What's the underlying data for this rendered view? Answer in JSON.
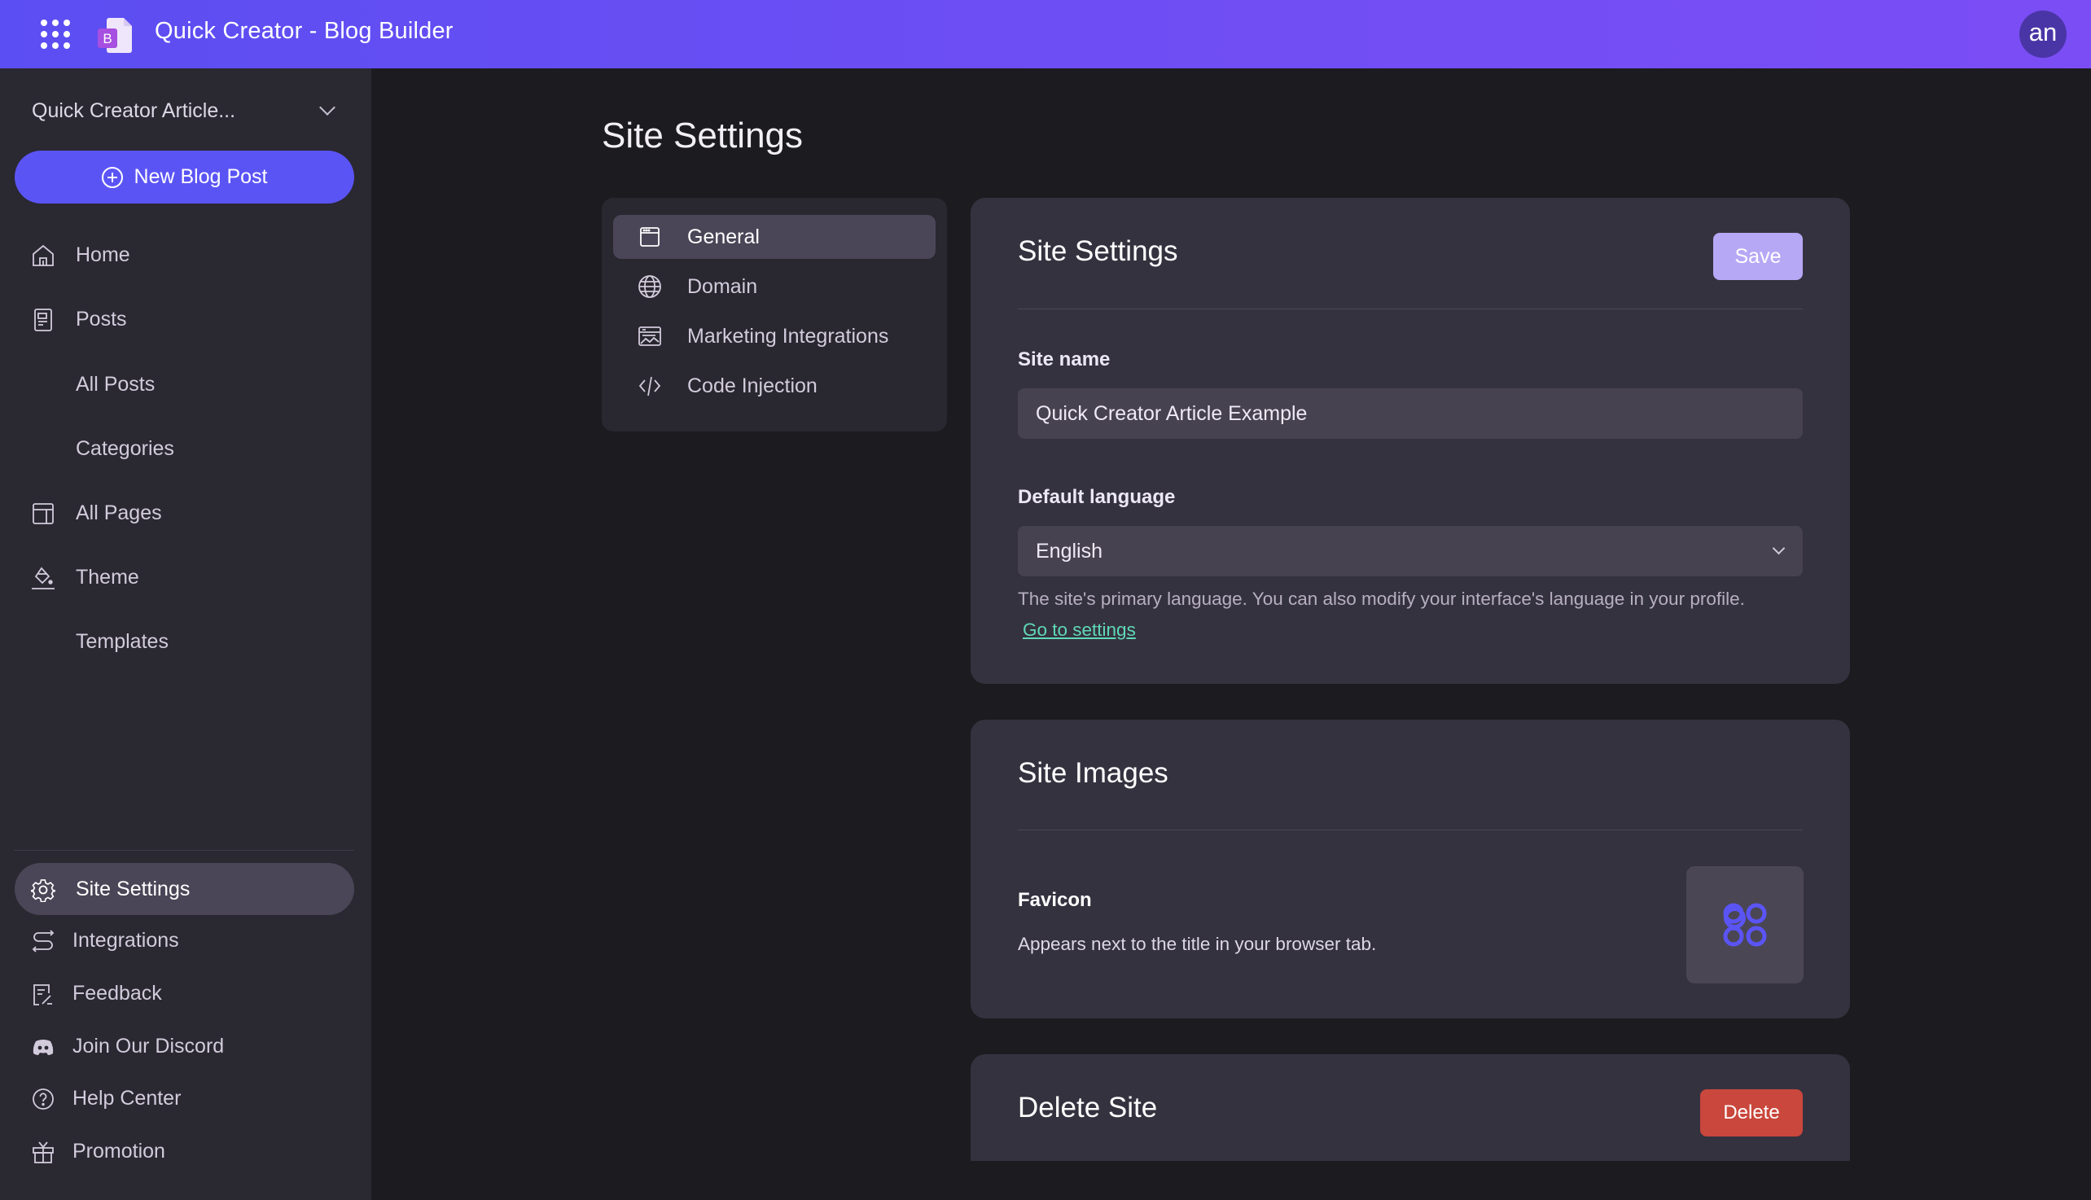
{
  "header": {
    "app_title": "Quick Creator - Blog Builder",
    "avatar_initials": "an",
    "brand_color": "#5b4ef2",
    "logo_letter": "B"
  },
  "sidebar": {
    "site_selector": "Quick Creator Article...",
    "new_post_label": "New Blog Post",
    "items": [
      {
        "label": "Home",
        "icon": "home-icon"
      },
      {
        "label": "Posts",
        "icon": "posts-icon"
      },
      {
        "label": "All Posts",
        "icon": ""
      },
      {
        "label": "Categories",
        "icon": ""
      },
      {
        "label": "All Pages",
        "icon": "pages-icon"
      },
      {
        "label": "Theme",
        "icon": "paint-bucket-icon"
      },
      {
        "label": "Templates",
        "icon": ""
      }
    ],
    "bottom_items": [
      {
        "label": "Site Settings",
        "icon": "gear-icon",
        "active": true
      },
      {
        "label": "Integrations",
        "icon": "integrations-icon"
      },
      {
        "label": "Feedback",
        "icon": "feedback-icon"
      },
      {
        "label": "Join Our Discord",
        "icon": "discord-icon"
      },
      {
        "label": "Help Center",
        "icon": "help-icon"
      },
      {
        "label": "Promotion",
        "icon": "gift-icon"
      }
    ]
  },
  "main": {
    "page_title": "Site Settings",
    "subnav": [
      {
        "label": "General",
        "icon": "browser-window-icon",
        "active": true
      },
      {
        "label": "Domain",
        "icon": "globe-icon"
      },
      {
        "label": "Marketing Integrations",
        "icon": "marketing-icon"
      },
      {
        "label": "Code Injection",
        "icon": "code-icon"
      }
    ],
    "settings_card": {
      "title": "Site Settings",
      "save_label": "Save",
      "site_name_label": "Site name",
      "site_name_value": "Quick Creator Article Example",
      "language_label": "Default language",
      "language_value": "English",
      "language_help": "The site's primary language. You can also modify your interface's language in your profile.",
      "settings_link": "Go to settings"
    },
    "images_card": {
      "title": "Site Images",
      "favicon_label": "Favicon",
      "favicon_desc": "Appears next to the title in your browser tab."
    },
    "delete_card": {
      "title": "Delete Site",
      "delete_label": "Delete",
      "delete_color": "#c9473c"
    }
  }
}
